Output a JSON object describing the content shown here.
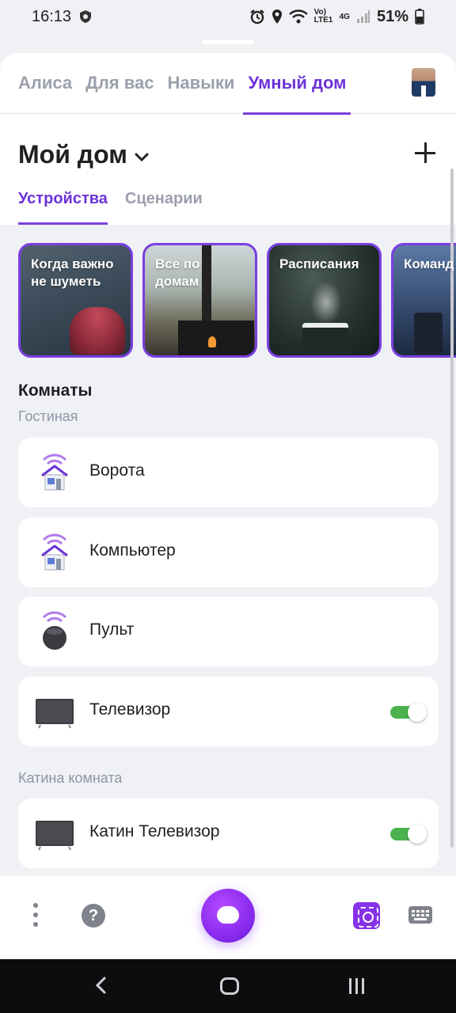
{
  "status_bar": {
    "time": "16:13",
    "network": "Vo) LTE1",
    "network_type": "4G",
    "battery": "51%",
    "icons": [
      "shield-icon",
      "alarm-icon",
      "location-icon",
      "wifi-icon",
      "signal-icon",
      "battery-icon"
    ]
  },
  "top_nav": {
    "tabs": [
      {
        "label": "Алиса"
      },
      {
        "label": "Для вас"
      },
      {
        "label": "Навыки"
      },
      {
        "label": "Умный дом"
      }
    ],
    "active_tab": "Умный дом"
  },
  "header": {
    "title": "Мой дом",
    "subtabs": [
      {
        "label": "Устройства"
      },
      {
        "label": "Сценарии"
      }
    ],
    "active_subtab": "Устройства"
  },
  "stories": [
    {
      "label": "Когда важно не шуметь"
    },
    {
      "label": "Все по домам"
    },
    {
      "label": "Расписания"
    },
    {
      "label": "Команд с тайме"
    }
  ],
  "rooms": {
    "title": "Комнаты",
    "groups": [
      {
        "name": "Гостиная",
        "devices": [
          {
            "name": "Ворота",
            "icon": "smart-home-icon"
          },
          {
            "name": "Компьютер",
            "icon": "smart-home-icon"
          },
          {
            "name": "Пульт",
            "icon": "remote-hub-icon"
          },
          {
            "name": "Телевизор",
            "icon": "tv-icon",
            "toggle": true
          }
        ]
      },
      {
        "name": "Катина комната",
        "devices": [
          {
            "name": "Катин Телевизор",
            "icon": "tv-icon",
            "toggle": true
          }
        ]
      }
    ]
  },
  "bottom_bar": {
    "help_glyph": "?"
  },
  "colors": {
    "accent": "#7a3fe0",
    "toggle_on": "#4ab34e",
    "background": "#f0f1f5"
  }
}
